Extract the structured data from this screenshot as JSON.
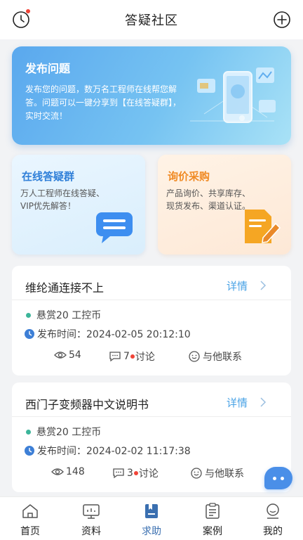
{
  "header": {
    "title": "答疑社区",
    "left_icon": "history-clock-icon",
    "right_icon": "add-circle-icon"
  },
  "hero": {
    "title": "发布问题",
    "desc": "发布您的问题，数万名工程师在线帮您解答。问题可以一键分享到【在线答疑群】，实时交流！"
  },
  "cards": {
    "group": {
      "title": "在线答疑群",
      "desc": "万人工程师在线答疑、VIP优先解答！"
    },
    "purchase": {
      "title": "询价采购",
      "desc": "产品询价、共享库存、现货发布、渠道认证。"
    }
  },
  "questions": [
    {
      "title": "维纶通连接不上",
      "detail": "详情",
      "reward": "悬赏20 工控币",
      "time": "发布时间：2024-02-05 20:12:10",
      "views": "54",
      "comments": "7",
      "comments_suffix": "讨论",
      "contact": "与他联系"
    },
    {
      "title": "西门子变频器中文说明书",
      "detail": "详情",
      "reward": "悬赏20 工控币",
      "time": "发布时间：2024-02-02 11:17:38",
      "views": "148",
      "comments": "3",
      "comments_suffix": "讨论",
      "contact": "与他联系"
    }
  ],
  "tabbar": {
    "items": [
      {
        "label": "首页",
        "icon": "home-icon"
      },
      {
        "label": "资料",
        "icon": "monitor-icon"
      },
      {
        "label": "求助",
        "icon": "help-book-icon",
        "active": true
      },
      {
        "label": "案例",
        "icon": "clipboard-icon"
      },
      {
        "label": "我的",
        "icon": "user-icon"
      }
    ]
  },
  "colors": {
    "accent": "#4aa3e6",
    "active_tab": "#3a6fb0",
    "notify_dot": "#f04438",
    "reward_dot": "#3cb59a"
  }
}
